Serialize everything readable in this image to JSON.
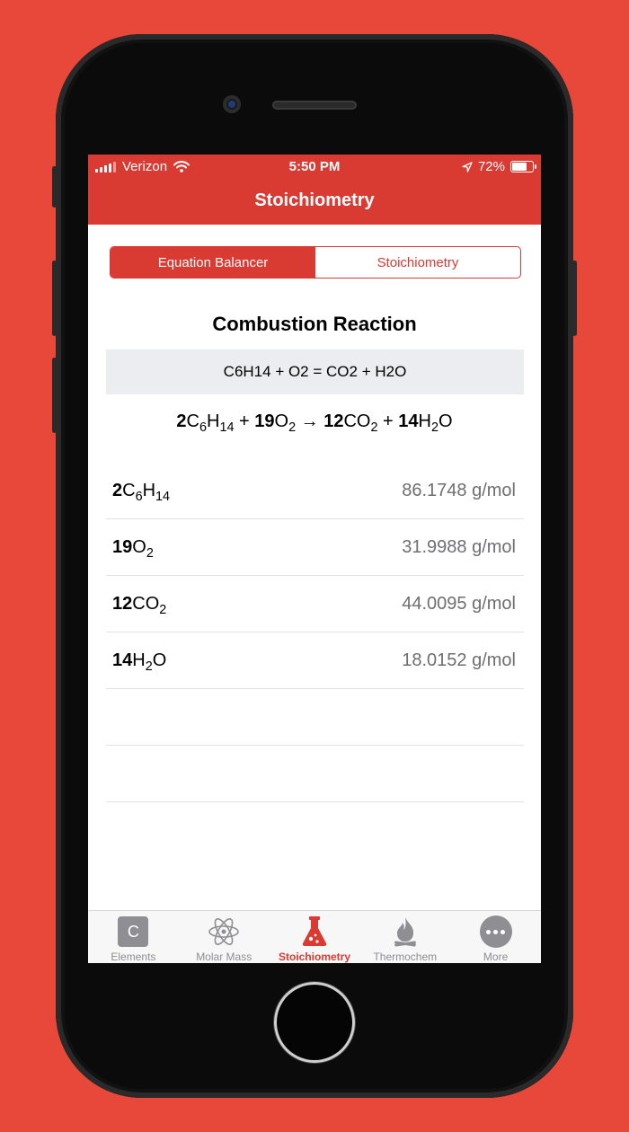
{
  "status_bar": {
    "carrier": "Verizon",
    "time": "5:50 PM",
    "battery": "72%"
  },
  "nav": {
    "title": "Stoichiometry"
  },
  "segments": [
    {
      "label": "Equation Balancer",
      "selected": true
    },
    {
      "label": "Stoichiometry",
      "selected": false
    }
  ],
  "reaction": {
    "title": "Combustion Reaction",
    "input": "C6H14 + O2 = CO2 + H2O",
    "balanced": [
      {
        "coef": "2",
        "formula": "C<sub>6</sub>H<sub>14</sub>"
      },
      {
        "op": " + "
      },
      {
        "coef": "19",
        "formula": "O<sub>2</sub>"
      },
      {
        "op": " → "
      },
      {
        "coef": "12",
        "formula": "CO<sub>2</sub>"
      },
      {
        "op": " + "
      },
      {
        "coef": "14",
        "formula": "H<sub>2</sub>O"
      }
    ]
  },
  "molar_masses": [
    {
      "coef": "2",
      "formula": "C<sub>6</sub>H<sub>14</sub>",
      "mass": "86.1748 g/mol"
    },
    {
      "coef": "19",
      "formula": "O<sub>2</sub>",
      "mass": "31.9988 g/mol"
    },
    {
      "coef": "12",
      "formula": "CO<sub>2</sub>",
      "mass": "44.0095 g/mol"
    },
    {
      "coef": "14",
      "formula": "H<sub>2</sub>O",
      "mass": "18.0152 g/mol"
    }
  ],
  "tabs": [
    {
      "label": "Elements",
      "icon": "element-c-icon",
      "glyph": "C",
      "active": false
    },
    {
      "label": "Molar Mass",
      "icon": "atom-icon",
      "active": false
    },
    {
      "label": "Stoichiometry",
      "icon": "flask-icon",
      "active": true
    },
    {
      "label": "Thermochem",
      "icon": "fire-icon",
      "active": false
    },
    {
      "label": "More",
      "icon": "more-icon",
      "active": false
    }
  ],
  "colors": {
    "accent": "#D93A32",
    "background": "#E8483A",
    "inactive": "#8e8e93"
  }
}
